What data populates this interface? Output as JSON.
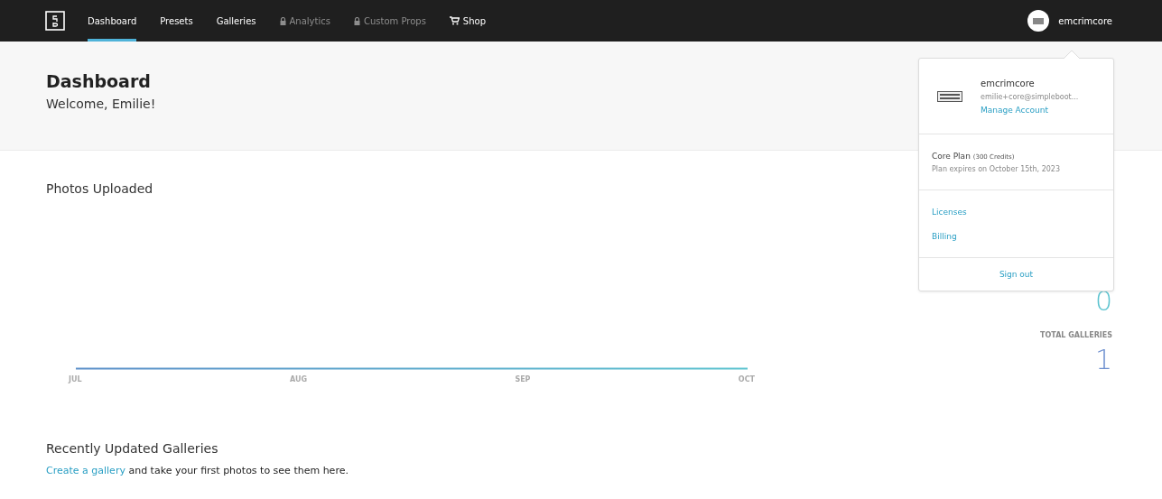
{
  "nav": {
    "items": [
      {
        "label": "Dashboard",
        "selected": true,
        "kind": "plain"
      },
      {
        "label": "Presets",
        "selected": false,
        "kind": "plain"
      },
      {
        "label": "Galleries",
        "selected": false,
        "kind": "plain"
      },
      {
        "label": "Analytics",
        "selected": false,
        "kind": "locked"
      },
      {
        "label": "Custom Props",
        "selected": false,
        "kind": "locked"
      },
      {
        "label": "Shop",
        "selected": false,
        "kind": "shop"
      }
    ],
    "username": "emcrimcore"
  },
  "header": {
    "title": "Dashboard",
    "welcome": "Welcome, Emilie!"
  },
  "photos": {
    "title": "Photos Uploaded",
    "x_labels": [
      "JUL",
      "AUG",
      "SEP",
      "OCT"
    ]
  },
  "stats": [
    {
      "value": "0"
    },
    {
      "label": "TOTAL GALLERIES",
      "value": "1"
    }
  ],
  "recent": {
    "title": "Recently Updated Galleries",
    "link": "Create a gallery",
    "text": "and take your first photos to see them here."
  },
  "account_menu": {
    "username": "emcrimcore",
    "email": "emilie+core@simpleboot...",
    "manage": "Manage Account",
    "plan": "Core Plan",
    "credits": "(300 Credits)",
    "expires": "Plan expires on October 15th, 2023",
    "links": [
      "Licenses",
      "Billing"
    ],
    "sign_out": "Sign out"
  }
}
